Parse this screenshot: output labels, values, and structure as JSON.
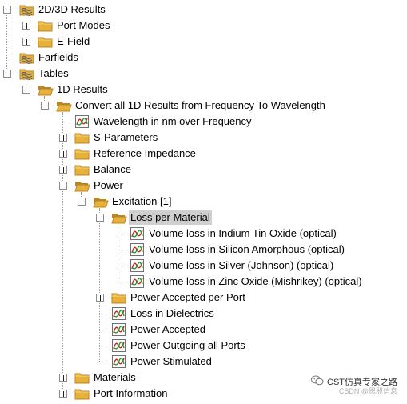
{
  "tree": {
    "nodes": [
      {
        "label": "2D/3D Results",
        "icon": "results-folder-icon",
        "level": 0,
        "toggle": "minus"
      },
      {
        "label": "Port Modes",
        "icon": "folder-icon",
        "level": 1,
        "toggle": "plus"
      },
      {
        "label": "E-Field",
        "icon": "folder-icon",
        "level": 1,
        "toggle": "plus"
      },
      {
        "label": "Farfields",
        "icon": "results-folder-icon",
        "level": 0,
        "toggle": "none"
      },
      {
        "label": "Tables",
        "icon": "results-folder-icon",
        "level": 0,
        "toggle": "minus"
      },
      {
        "label": "1D Results",
        "icon": "folder-open-icon",
        "level": 1,
        "toggle": "minus"
      },
      {
        "label": "Convert all 1D Results from Frequency To Wavelength",
        "icon": "folder-open-icon",
        "level": 2,
        "toggle": "minus"
      },
      {
        "label": "Wavelength in nm over Frequency",
        "icon": "curve-plot-icon",
        "level": 3,
        "toggle": "none"
      },
      {
        "label": "S-Parameters",
        "icon": "folder-icon",
        "level": 3,
        "toggle": "plus"
      },
      {
        "label": "Reference Impedance",
        "icon": "folder-icon",
        "level": 3,
        "toggle": "plus"
      },
      {
        "label": "Balance",
        "icon": "folder-icon",
        "level": 3,
        "toggle": "plus"
      },
      {
        "label": "Power",
        "icon": "folder-open-icon",
        "level": 3,
        "toggle": "minus"
      },
      {
        "label": "Excitation [1]",
        "icon": "folder-open-icon",
        "level": 4,
        "toggle": "minus"
      },
      {
        "label": "Loss per Material",
        "icon": "folder-open-icon",
        "level": 5,
        "toggle": "minus",
        "selected": true
      },
      {
        "label": "Volume loss in Indium Tin Oxide (optical)",
        "icon": "curve-plot-icon",
        "level": 6,
        "toggle": "none"
      },
      {
        "label": "Volume loss in Silicon Amorphous (optical)",
        "icon": "curve-plot-icon",
        "level": 6,
        "toggle": "none"
      },
      {
        "label": "Volume loss in Silver (Johnson) (optical)",
        "icon": "curve-plot-icon",
        "level": 6,
        "toggle": "none"
      },
      {
        "label": "Volume loss in Zinc Oxide (Mishrikey) (optical)",
        "icon": "curve-plot-icon",
        "level": 6,
        "toggle": "none"
      },
      {
        "label": "Power Accepted per Port",
        "icon": "folder-icon",
        "level": 5,
        "toggle": "plus"
      },
      {
        "label": "Loss in Dielectrics",
        "icon": "curve-plot-icon",
        "level": 5,
        "toggle": "none"
      },
      {
        "label": "Power Accepted",
        "icon": "curve-plot-icon",
        "level": 5,
        "toggle": "none"
      },
      {
        "label": "Power Outgoing all Ports",
        "icon": "curve-plot-icon",
        "level": 5,
        "toggle": "none"
      },
      {
        "label": "Power Stimulated",
        "icon": "curve-plot-icon",
        "level": 5,
        "toggle": "none"
      },
      {
        "label": "Materials",
        "icon": "folder-icon",
        "level": 3,
        "toggle": "plus"
      },
      {
        "label": "Port Information",
        "icon": "folder-icon",
        "level": 3,
        "toggle": "plus"
      }
    ]
  },
  "watermark": {
    "main": "CST仿真专家之路",
    "sub": "CSDN @恩殷信息"
  },
  "colors": {
    "folder": "#e8b13a",
    "folder_dark": "#b8862a",
    "selection": "#cfcfcf"
  }
}
